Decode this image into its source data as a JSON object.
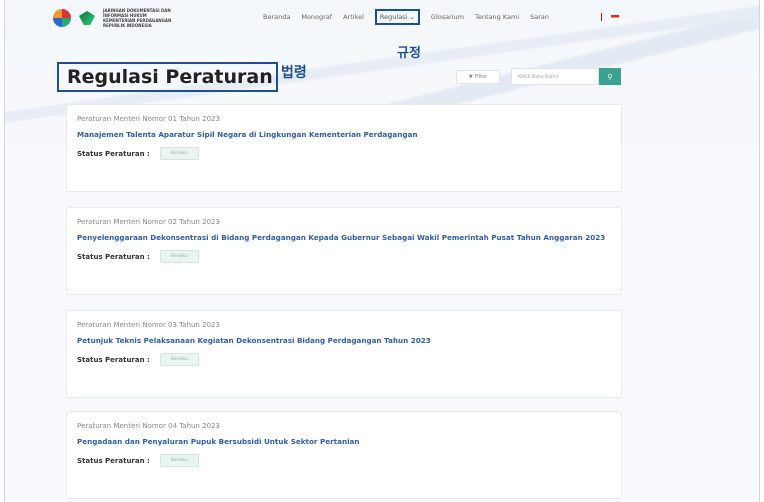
{
  "header": {
    "logo_lines": [
      "JARINGAN DOKUMENTASI DAN",
      "INFORMASI HUKUM",
      "KEMENTERIAN PERDAGANGAN",
      "REPUBLIK INDONESIA"
    ],
    "nav": [
      "Beranda",
      "Monograf",
      "Artikel",
      "Regulasi",
      "Glosarium",
      "Tentang Kami",
      "Saran"
    ],
    "active_nav": "Regulasi",
    "dropdown_icon": "chevron-down-icon"
  },
  "annotations": {
    "regulation_ko": "규정",
    "law_ko": "법령"
  },
  "page": {
    "title": "Regulasi Peraturan",
    "filter_label": "Filter",
    "search_placeholder": "Ketik Kata Kunci",
    "search_icon": "search-icon"
  },
  "regulations": [
    {
      "number": "Peraturan Menteri Nomor 01 Tahun 2023",
      "title": "Manajemen Talenta Aparatur Sipil Negara di Lingkungan Kementerian Perdagangan",
      "status_label": "Status Peraturan :",
      "status": "Berlaku"
    },
    {
      "number": "Peraturan Menteri Nomor 02 Tahun 2023",
      "title": "Penyelenggaraan Dekonsentrasi di Bidang Perdagangan Kepada Gubernur Sebagai Wakil Pemerintah Pusat Tahun Anggaran 2023",
      "status_label": "Status Peraturan :",
      "status": "Berlaku"
    },
    {
      "number": "Peraturan Menteri Nomor 03 Tahun 2023",
      "title": "Petunjuk Teknis Pelaksanaan Kegiatan Dekonsentrasi Bidang Perdagangan Tahun 2023",
      "status_label": "Status Peraturan :",
      "status": "Berlaku"
    },
    {
      "number": "Peraturan Menteri Nomor 04 Tahun 2023",
      "title": "Pengadaan dan Penyaluran Pupuk Bersubsidi Untuk Sektor Pertanian",
      "status_label": "Status Peraturan :",
      "status": "Berlaku"
    }
  ],
  "colors": {
    "accent": "#1f4f8f",
    "link": "#2e5ea8",
    "search_button": "#3aa28e"
  }
}
